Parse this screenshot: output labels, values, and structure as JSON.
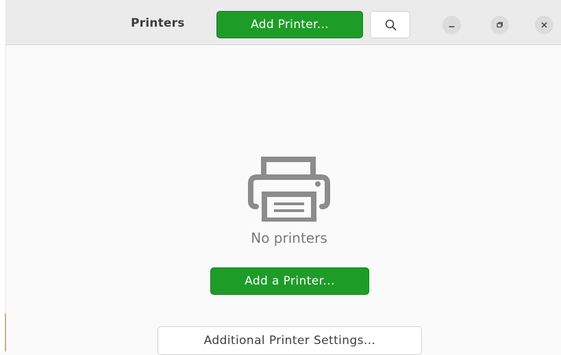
{
  "window": {
    "title": "Printers",
    "controls": [
      "minimize-icon",
      "restore-icon",
      "close-icon"
    ]
  },
  "header": {
    "add_printer_label": "Add Printer...",
    "search_icon": "search-icon"
  },
  "empty_state": {
    "icon": "printer-icon",
    "message": "No printers",
    "add_button_label": "Add a Printer..."
  },
  "footer": {
    "additional_settings_label": "Additional Printer Settings..."
  },
  "colors": {
    "accent_green": "#1e9c28",
    "headerbar_bg": "#ebebeb",
    "content_bg": "#fafafa"
  }
}
